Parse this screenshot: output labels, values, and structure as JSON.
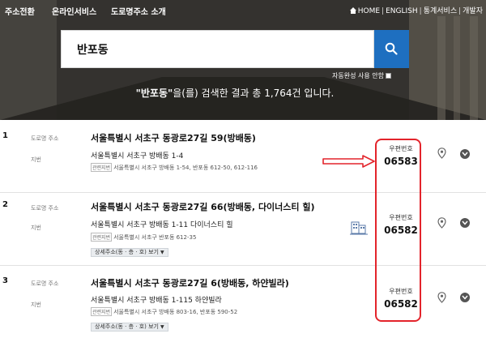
{
  "topnav": {
    "items": [
      "주소전환",
      "온라인서비스",
      "도로명주소 소개"
    ],
    "utility": [
      "HOME",
      "ENGLISH",
      "통계서비스",
      "개발자"
    ]
  },
  "search": {
    "value": "반포동",
    "button_icon": "search-icon"
  },
  "autocomplete": {
    "label": "자동완성 사용 안함"
  },
  "summary": {
    "keyword": "\"반포동\"",
    "text": "을(를) 검색한 결과 총 1,764건 입니다."
  },
  "labels": {
    "road": "도로명 주소",
    "jibun": "지번",
    "related_tag": "관련지번",
    "zip": "우편번호",
    "detail": "상세주소(동 · 층 · 호) 보기"
  },
  "results": [
    {
      "num": "1",
      "road": "서울특별시 서초구 동광로27길 59(방배동)",
      "jibun": "서울특별시 서초구 방배동 1-4",
      "related": "서울특별시 서초구 방배동 1-54, 반포동 612-50, 612-116",
      "zip": "06583"
    },
    {
      "num": "2",
      "road": "서울특별시 서초구 동광로27길 66(방배동, 다이너스티 힐)",
      "jibun": "서울특별시 서초구 방배동 1-11 다이너스티 힐",
      "related": "서울특별시 서초구 반포동 612-35",
      "zip": "06582"
    },
    {
      "num": "3",
      "road": "서울특별시 서초구 동광로27길 6(방배동, 하얀빌라)",
      "jibun": "서울특별시 서초구 방배동 1-115 하얀빌라",
      "related": "서울특별시 서초구 방배동 803-16, 반포동 590-52",
      "zip": "06582"
    }
  ],
  "colors": {
    "accent": "#1e6fc0",
    "highlight": "#e3242b"
  }
}
